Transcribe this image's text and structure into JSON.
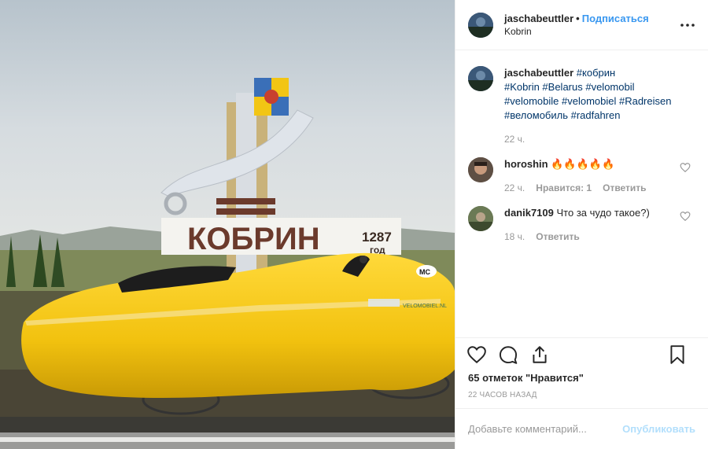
{
  "header": {
    "username": "jaschabeuttler",
    "separator": "•",
    "follow_label": "Подписаться",
    "location": "Kobrin",
    "more_icon": "more-horizontal-icon"
  },
  "photo": {
    "sign_text": "КОБРИН",
    "sign_year": "1287",
    "sign_year_suffix": "год",
    "badge": "MC",
    "sticker": "VELOMOBIEL.NL"
  },
  "caption": {
    "username": "jaschabeuttler",
    "tags_line1": "#кобрин",
    "tags_line2": "#Kobrin #Belarus #velomobil",
    "tags_line3": "#velomobile #velomobiel #Radreisen",
    "tags_line4": "#веломобиль #radfahren",
    "time": "22 ч."
  },
  "comments": [
    {
      "username": "horoshin",
      "text": "🔥🔥🔥🔥🔥",
      "time": "22 ч.",
      "likes": "Нравится: 1",
      "reply": "Ответить"
    },
    {
      "username": "danik7109",
      "text": "Что за чудо такое?)",
      "time": "18 ч.",
      "reply": "Ответить"
    }
  ],
  "actions": {
    "likes": "65 отметок \"Нравится\"",
    "timestamp": "22 ЧАСОВ НАЗАД"
  },
  "add_comment": {
    "placeholder": "Добавьте комментарий...",
    "publish": "Опубликовать"
  },
  "colors": {
    "link": "#3897f0",
    "hashtag": "#003569",
    "velomobile": "#f5c518"
  }
}
